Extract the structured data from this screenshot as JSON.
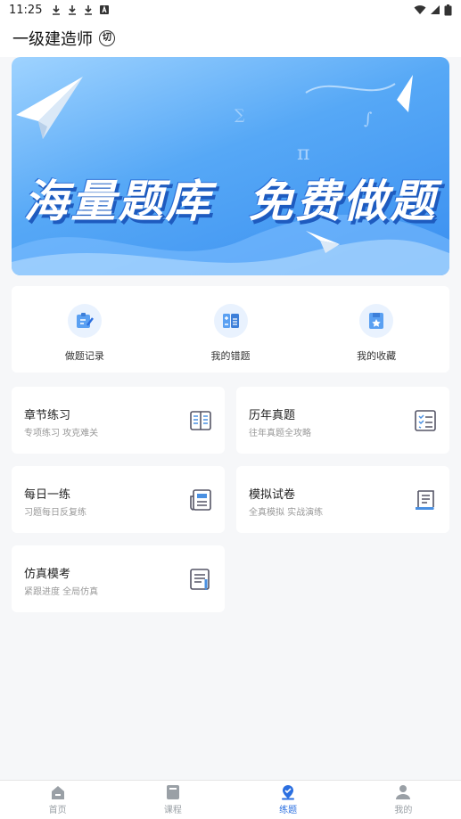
{
  "status_bar": {
    "time": "11:25"
  },
  "header": {
    "title": "一级建造师",
    "switch_icon_text": "切"
  },
  "banner": {
    "left_text": "海量题库",
    "right_text": "免费做题"
  },
  "quick_actions": [
    {
      "label": "做题记录",
      "icon": "edit-record-icon"
    },
    {
      "label": "我的错题",
      "icon": "wrong-questions-icon"
    },
    {
      "label": "我的收藏",
      "icon": "favorites-icon"
    }
  ],
  "practice": [
    {
      "title": "章节练习",
      "subtitle": "专项练习 攻克难关",
      "icon": "book-icon"
    },
    {
      "title": "历年真题",
      "subtitle": "往年真题全攻略",
      "icon": "checklist-icon"
    },
    {
      "title": "每日一练",
      "subtitle": "习题每日反复练",
      "icon": "newspaper-icon"
    },
    {
      "title": "模拟试卷",
      "subtitle": "全真模拟 实战演练",
      "icon": "scroll-icon"
    },
    {
      "title": "仿真模考",
      "subtitle": "紧跟进度 全局仿真",
      "icon": "exam-sheet-icon"
    }
  ],
  "bottom_nav": [
    {
      "label": "首页",
      "icon": "home-icon",
      "active": false
    },
    {
      "label": "课程",
      "icon": "course-icon",
      "active": false
    },
    {
      "label": "练题",
      "icon": "practice-icon",
      "active": true
    },
    {
      "label": "我的",
      "icon": "profile-icon",
      "active": false
    }
  ],
  "colors": {
    "accent": "#2b6fe0",
    "banner_blue": "#3a8ff0",
    "icon_blue": "#4a90e2",
    "background": "#f6f7f9"
  }
}
